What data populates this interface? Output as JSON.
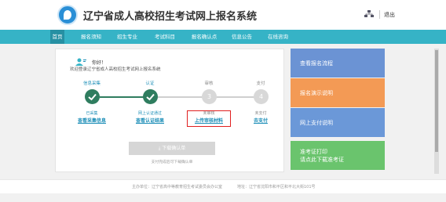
{
  "header": {
    "site_title": "辽宁省成人高校招生考试网上报名系统",
    "logout_label": "退出",
    "org_icon": "sitemap-icon",
    "logo_icon": "logo-icon"
  },
  "nav": {
    "items": [
      {
        "label": "首页",
        "active": true
      },
      {
        "label": "报名须知"
      },
      {
        "label": "招生专业"
      },
      {
        "label": "考试科目"
      },
      {
        "label": "报名确认点"
      },
      {
        "label": "信息公告"
      },
      {
        "label": "在线咨询"
      }
    ]
  },
  "main": {
    "greeting": "你好！",
    "welcome": "欢迎登录辽宁省成人高校招生考试网上报名系统",
    "steps": [
      {
        "name": "信息采集",
        "status": "已采集",
        "link": "查看采集信息",
        "done": true,
        "number": ""
      },
      {
        "name": "认证",
        "status": "网上认证通过",
        "link": "查看认证结果",
        "done": true,
        "number": ""
      },
      {
        "name": "审核",
        "status": "未审核",
        "link": "上传审核材料",
        "done": false,
        "number": "3"
      },
      {
        "name": "支付",
        "status": "未支付",
        "link": "去支付",
        "done": false,
        "number": "4"
      }
    ],
    "download_button": "下载确认单",
    "download_hint": "支付完成后可下载确认单"
  },
  "side_cards": [
    {
      "label": "查看报名流程",
      "color": "#6b93d4"
    },
    {
      "label": "报名演示说明",
      "color": "#f39a55"
    },
    {
      "label": "网上支付说明",
      "color": "#6b98d8"
    },
    {
      "label": "准考证打印",
      "label2": "请点此下载准考证",
      "color": "#6ac46d"
    }
  ],
  "footer": {
    "host": "主办单位：辽宁省高中等教育招生考试委员会办公室",
    "address": "地址：辽宁省沈阳市和平区和平北大街101号"
  },
  "colors": {
    "nav_bg": "#36b3c6",
    "step_done": "#2f7d5f",
    "highlight": "#e02020"
  }
}
